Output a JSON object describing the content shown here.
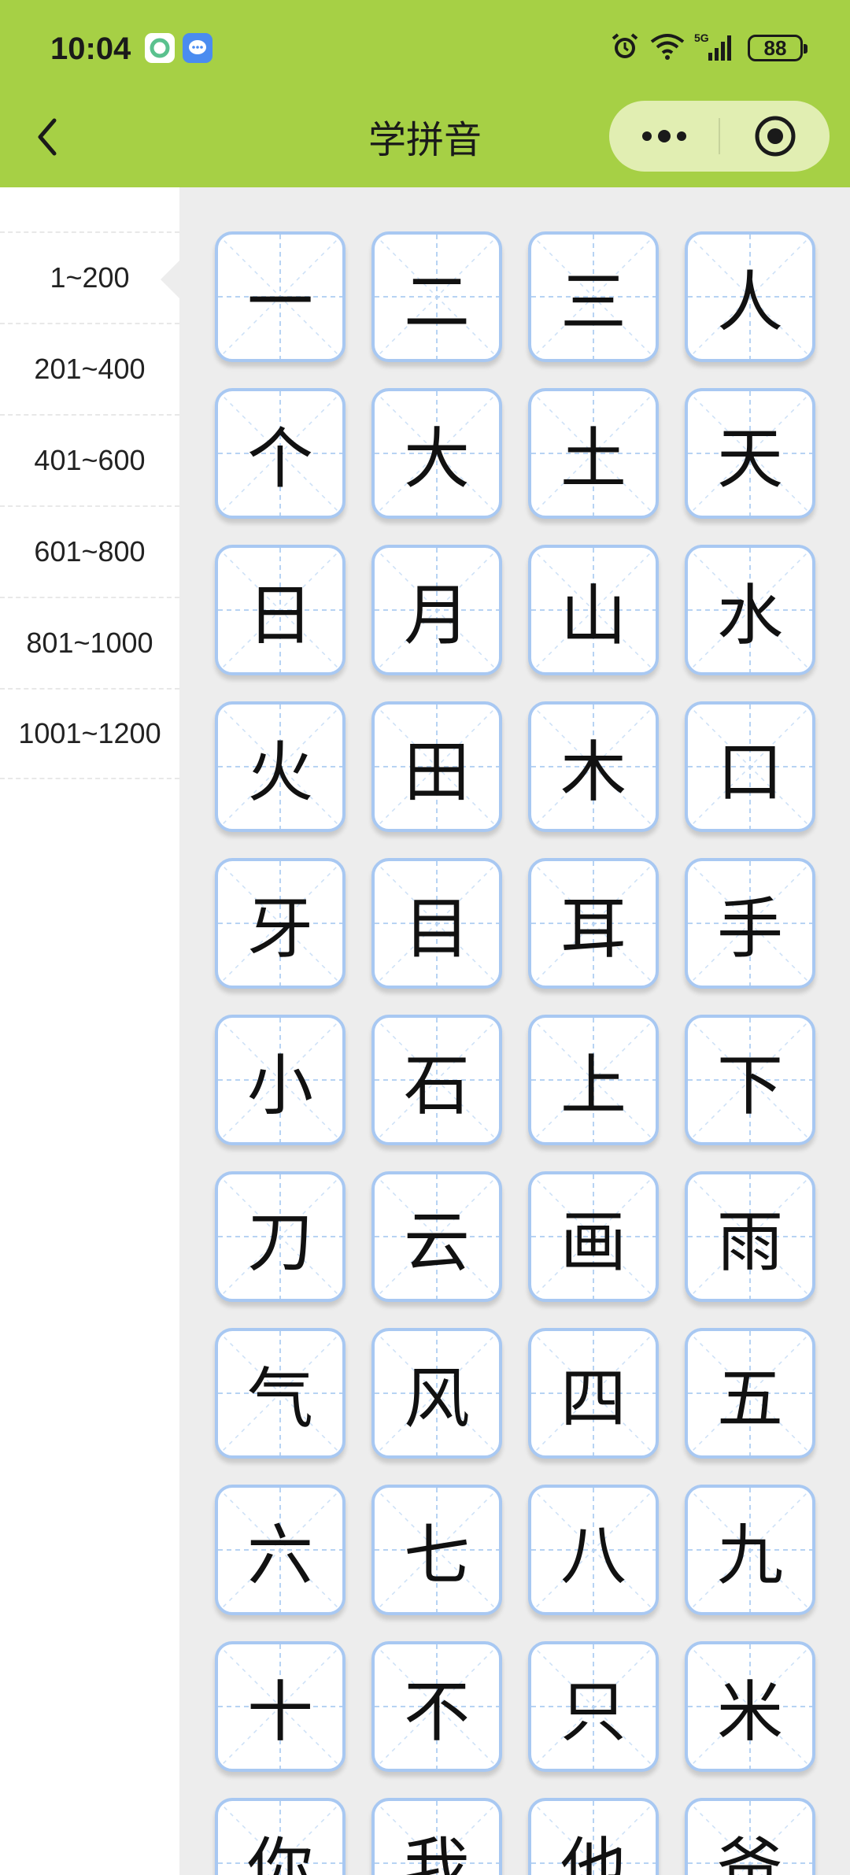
{
  "status_bar": {
    "time": "10:04",
    "battery": "88"
  },
  "header": {
    "title": "学拼音"
  },
  "sidebar": {
    "items": [
      {
        "label": "1~200"
      },
      {
        "label": "201~400"
      },
      {
        "label": "401~600"
      },
      {
        "label": "601~800"
      },
      {
        "label": "801~1000"
      },
      {
        "label": "1001~1200"
      }
    ],
    "active_index": 0
  },
  "characters": [
    "一",
    "二",
    "三",
    "人",
    "个",
    "大",
    "土",
    "天",
    "日",
    "月",
    "山",
    "水",
    "火",
    "田",
    "木",
    "口",
    "牙",
    "目",
    "耳",
    "手",
    "小",
    "石",
    "上",
    "下",
    "刀",
    "云",
    "画",
    "雨",
    "气",
    "风",
    "四",
    "五",
    "六",
    "七",
    "八",
    "九",
    "十",
    "不",
    "只",
    "米",
    "你",
    "我",
    "他",
    "爸"
  ],
  "colors": {
    "header_bg": "#a6d045",
    "card_border": "#a8c8f2",
    "guide_line": "#b7d3f3"
  }
}
